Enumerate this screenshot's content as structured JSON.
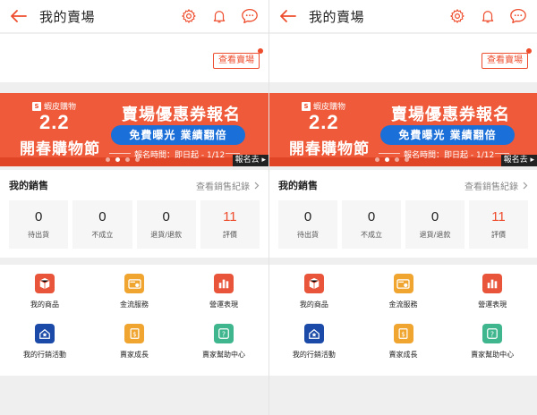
{
  "header": {
    "title": "我的賣場"
  },
  "shop": {
    "view_shop_label": "查看賣場"
  },
  "banner": {
    "brand": "蝦皮購物",
    "date": "2.2",
    "subtitle": "開春購物節",
    "headline": "賣場優惠券報名",
    "pill": "免費曝光 業績翻倍",
    "reg_time": "報名時間：即日起 - 1/12",
    "cta": "報名去",
    "colors": {
      "bg": "#ee5a3a",
      "pill": "#1a6fd8"
    }
  },
  "sales": {
    "title": "我的銷售",
    "history_link": "查看銷售紀錄",
    "stats": [
      {
        "value": "0",
        "label": "待出貨"
      },
      {
        "value": "0",
        "label": "不成立"
      },
      {
        "value": "0",
        "label": "退貨/退款"
      },
      {
        "value": "11",
        "label": "評價"
      }
    ]
  },
  "tools": [
    {
      "label": "我的商品",
      "icon": "box-icon",
      "color": "#e8553a"
    },
    {
      "label": "金流服務",
      "icon": "wallet-icon",
      "color": "#f0a531"
    },
    {
      "label": "營運表現",
      "icon": "bar-chart-icon",
      "color": "#e8553a"
    },
    {
      "label": "我的行銷活動",
      "icon": "marketing-icon",
      "color": "#1b4aa8"
    },
    {
      "label": "賣家成長",
      "icon": "growth-icon",
      "color": "#f0a531"
    },
    {
      "label": "賣家幫助中心",
      "icon": "help-icon",
      "color": "#3fb68e"
    }
  ],
  "colors": {
    "accent": "#ee4d2d"
  }
}
